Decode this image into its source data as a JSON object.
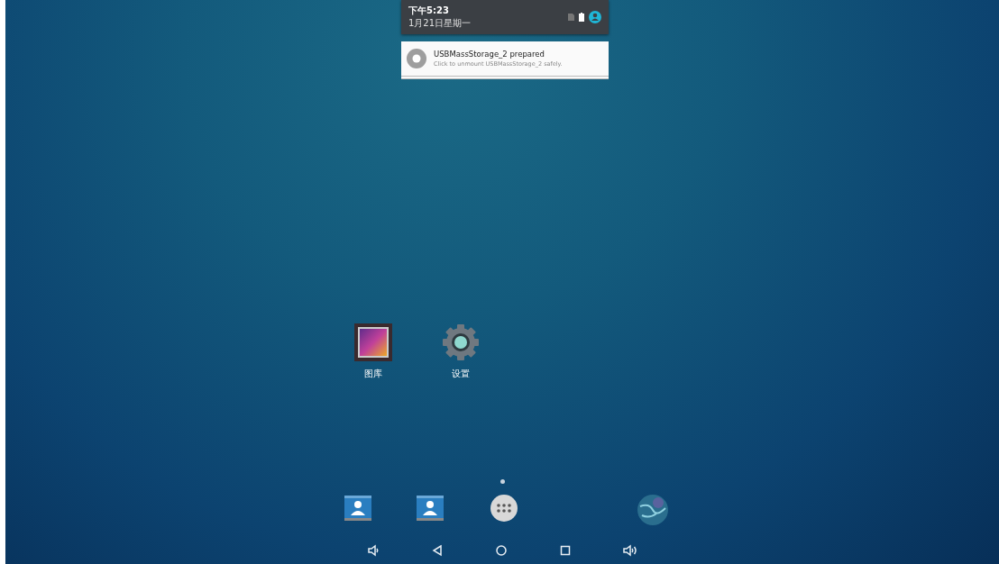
{
  "status_panel": {
    "time": "下午5:23",
    "date": "1月21日星期一"
  },
  "notification": {
    "title": "USBMassStorage_2 prepared",
    "text": "Click to unmount USBMassStorage_2 safely."
  },
  "apps": [
    {
      "label": "图库",
      "kind": "gallery"
    },
    {
      "label": "设置",
      "kind": "settings"
    }
  ],
  "pages": [
    {
      "selected": true
    }
  ],
  "dock": [
    {
      "kind": "contacts"
    },
    {
      "kind": "contacts"
    },
    {
      "kind": "all-apps"
    },
    {
      "kind": "globe"
    }
  ],
  "nav_bar": [
    {
      "kind": "volume-down"
    },
    {
      "kind": "back"
    },
    {
      "kind": "home"
    },
    {
      "kind": "recents"
    },
    {
      "kind": "volume-up"
    }
  ]
}
